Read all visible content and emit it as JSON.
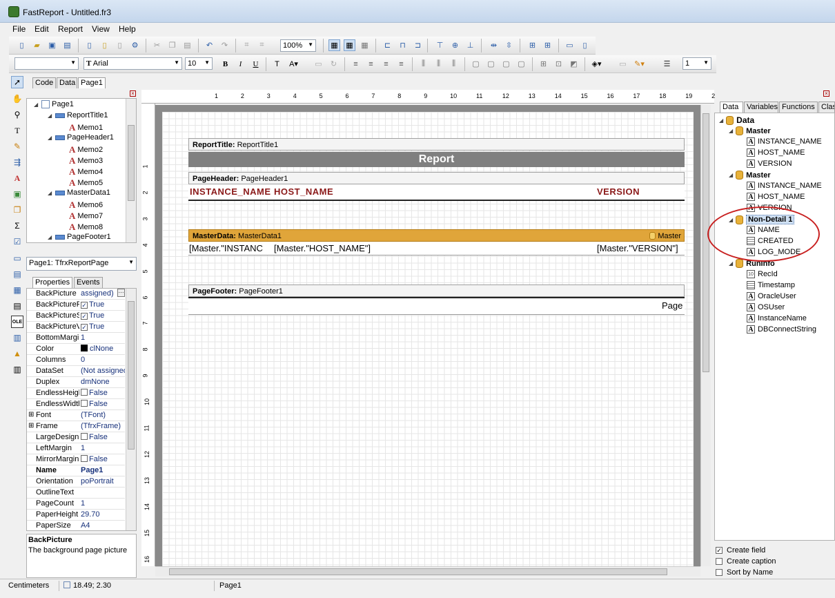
{
  "window": {
    "title": "FastReport - Untitled.fr3"
  },
  "menu": [
    "File",
    "Edit",
    "Report",
    "View",
    "Help"
  ],
  "toolbar": {
    "zoom": "100%",
    "font_name": "Arial",
    "font_size": "10",
    "frame_width": "1"
  },
  "tabs": [
    "Code",
    "Data",
    "Page1"
  ],
  "report_tree": [
    {
      "label": "Page1",
      "type": "page",
      "indent": 0
    },
    {
      "label": "ReportTitle1",
      "type": "band",
      "indent": 1
    },
    {
      "label": "Memo1",
      "type": "memo",
      "indent": 2
    },
    {
      "label": "PageHeader1",
      "type": "band",
      "indent": 1
    },
    {
      "label": "Memo2",
      "type": "memo",
      "indent": 2
    },
    {
      "label": "Memo3",
      "type": "memo",
      "indent": 2
    },
    {
      "label": "Memo4",
      "type": "memo",
      "indent": 2
    },
    {
      "label": "Memo5",
      "type": "memo",
      "indent": 2
    },
    {
      "label": "MasterData1",
      "type": "band",
      "indent": 1
    },
    {
      "label": "Memo6",
      "type": "memo",
      "indent": 2
    },
    {
      "label": "Memo7",
      "type": "memo",
      "indent": 2
    },
    {
      "label": "Memo8",
      "type": "memo",
      "indent": 2
    },
    {
      "label": "PageFooter1",
      "type": "band",
      "indent": 1
    }
  ],
  "object_selector": "Page1: TfrxReportPage",
  "property_tabs": [
    "Properties",
    "Events"
  ],
  "properties": [
    {
      "name": "BackPicture",
      "value": "assigned)",
      "kind": "text"
    },
    {
      "name": "BackPictureP",
      "value": "True",
      "kind": "check"
    },
    {
      "name": "BackPictureS",
      "value": "True",
      "kind": "check"
    },
    {
      "name": "BackPictureV",
      "value": "True",
      "kind": "check"
    },
    {
      "name": "BottomMargin",
      "value": "1",
      "kind": "text"
    },
    {
      "name": "Color",
      "value": "clNone",
      "kind": "color"
    },
    {
      "name": "Columns",
      "value": "0",
      "kind": "text"
    },
    {
      "name": "DataSet",
      "value": "(Not assigned",
      "kind": "text"
    },
    {
      "name": "Duplex",
      "value": "dmNone",
      "kind": "text"
    },
    {
      "name": "EndlessHeigh",
      "value": "False",
      "kind": "uncheck"
    },
    {
      "name": "EndlessWidth",
      "value": "False",
      "kind": "uncheck"
    },
    {
      "name": "Font",
      "value": "(TFont)",
      "kind": "expand"
    },
    {
      "name": "Frame",
      "value": "(TfrxFrame)",
      "kind": "expand"
    },
    {
      "name": "LargeDesign",
      "value": "False",
      "kind": "uncheck"
    },
    {
      "name": "LeftMargin",
      "value": "1",
      "kind": "text"
    },
    {
      "name": "MirrorMargins",
      "value": "False",
      "kind": "uncheck"
    },
    {
      "name": "Name",
      "value": "Page1",
      "kind": "bold"
    },
    {
      "name": "Orientation",
      "value": "poPortrait",
      "kind": "text"
    },
    {
      "name": "OutlineText",
      "value": "",
      "kind": "text"
    },
    {
      "name": "PageCount",
      "value": "1",
      "kind": "text"
    },
    {
      "name": "PaperHeight",
      "value": "29.70",
      "kind": "text"
    },
    {
      "name": "PaperSize",
      "value": "A4",
      "kind": "text"
    }
  ],
  "description": {
    "title": "BackPicture",
    "text": "The background page picture"
  },
  "ruler_h": [
    "1",
    "2",
    "3",
    "4",
    "5",
    "6",
    "7",
    "8",
    "9",
    "10",
    "11",
    "12",
    "13",
    "14",
    "15",
    "16",
    "17",
    "18",
    "19",
    "2"
  ],
  "ruler_v": [
    "1",
    "2",
    "3",
    "4",
    "5",
    "6",
    "7",
    "8",
    "9",
    "10",
    "11",
    "12",
    "13",
    "14",
    "15",
    "16"
  ],
  "report": {
    "title_band": {
      "kind": "ReportTitle:",
      "name": "ReportTitle1",
      "text": "Report"
    },
    "header_band": {
      "kind": "PageHeader:",
      "name": "PageHeader1",
      "cols": [
        "INSTANCE_NAME",
        "HOST_NAME",
        "VERSION"
      ]
    },
    "master_band": {
      "kind": "MasterData:",
      "name": "MasterData1",
      "source": "Master",
      "cols": [
        "[Master.\"INSTANC",
        "[Master.\"HOST_NAME\"]",
        "[Master.\"VERSION\"]"
      ]
    },
    "footer_band": {
      "kind": "PageFooter:",
      "name": "PageFooter1",
      "text": "Page"
    }
  },
  "data_tabs": [
    "Data",
    "Variables",
    "Functions",
    "Clas"
  ],
  "data_tree": [
    {
      "label": "Data",
      "type": "root",
      "indent": 0
    },
    {
      "label": "Master",
      "type": "db",
      "indent": 1
    },
    {
      "label": "INSTANCE_NAME",
      "type": "a",
      "indent": 2
    },
    {
      "label": "HOST_NAME",
      "type": "a",
      "indent": 2
    },
    {
      "label": "VERSION",
      "type": "a",
      "indent": 2
    },
    {
      "label": "Master",
      "type": "db",
      "indent": 1
    },
    {
      "label": "INSTANCE_NAME",
      "type": "a",
      "indent": 2
    },
    {
      "label": "HOST_NAME",
      "type": "a",
      "indent": 2
    },
    {
      "label": "VERSION",
      "type": "a",
      "indent": 2
    },
    {
      "label": "Non-Detail 1",
      "type": "db-sel",
      "indent": 1
    },
    {
      "label": "NAME",
      "type": "a",
      "indent": 2
    },
    {
      "label": "CREATED",
      "type": "grid",
      "indent": 2
    },
    {
      "label": "LOG_MODE",
      "type": "a",
      "indent": 2
    },
    {
      "label": "RunInfo",
      "type": "db",
      "indent": 1
    },
    {
      "label": "RecId",
      "type": "num",
      "indent": 2
    },
    {
      "label": "Timestamp",
      "type": "grid",
      "indent": 2
    },
    {
      "label": "OracleUser",
      "type": "a",
      "indent": 2
    },
    {
      "label": "OSUser",
      "type": "a",
      "indent": 2
    },
    {
      "label": "InstanceName",
      "type": "a",
      "indent": 2
    },
    {
      "label": "DBConnectString",
      "type": "a",
      "indent": 2
    }
  ],
  "data_options": [
    {
      "label": "Create field",
      "checked": true
    },
    {
      "label": "Create caption",
      "checked": false
    },
    {
      "label": "Sort by Name",
      "checked": false
    }
  ],
  "status": {
    "units": "Centimeters",
    "coords": "18.49; 2.30",
    "page": "Page1"
  },
  "colors": {
    "title_band": "#808080",
    "master_band": "#e0a53a",
    "header_text": "#8b1a1a",
    "annotation": "#c82020"
  }
}
